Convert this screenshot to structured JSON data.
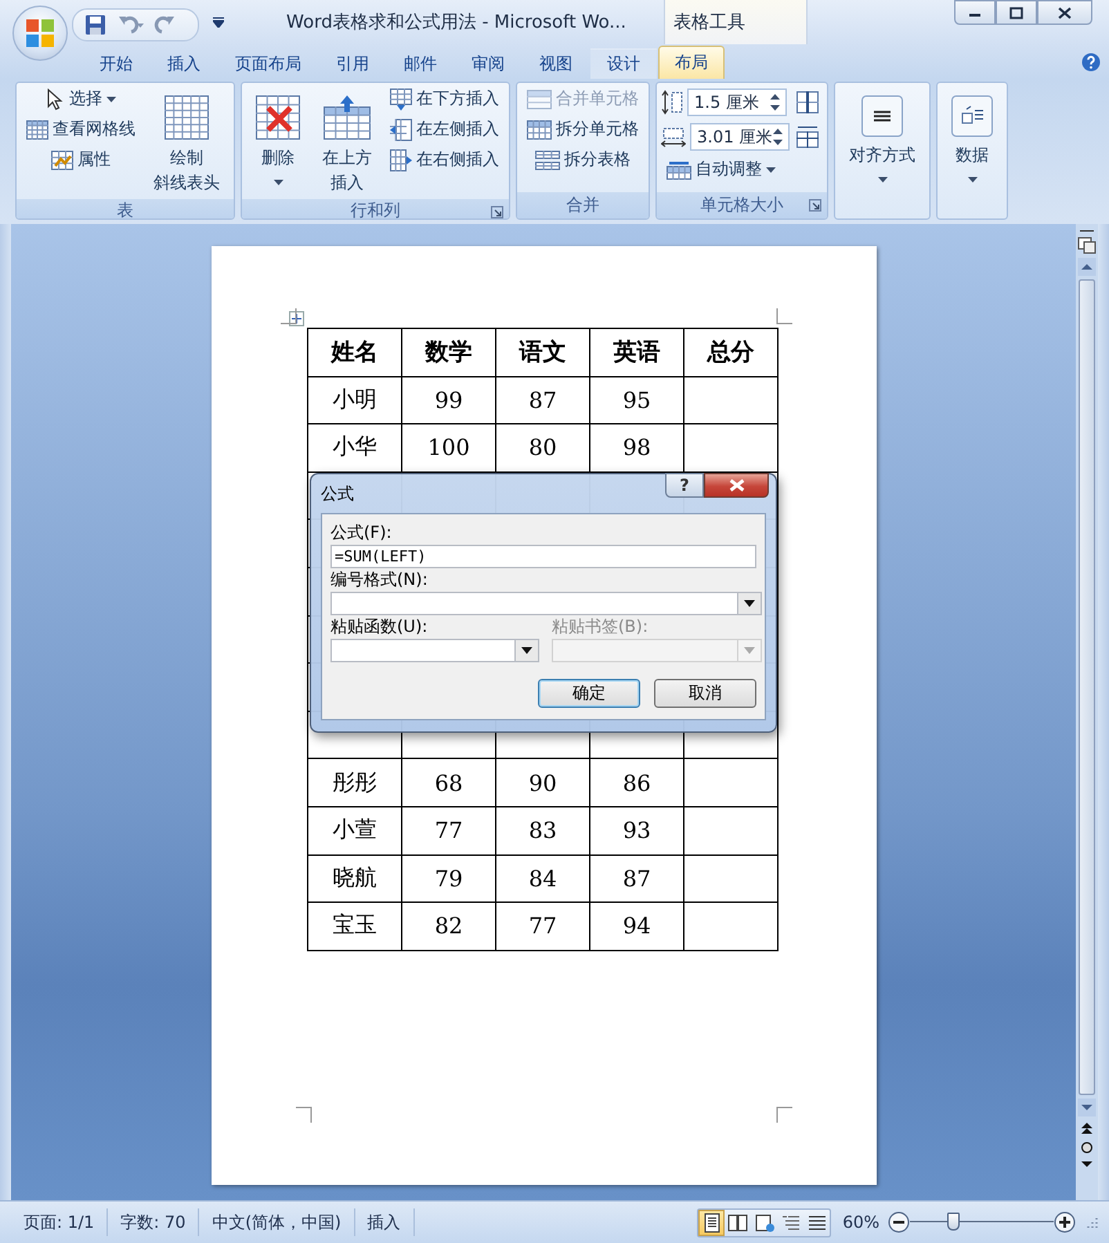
{
  "window": {
    "title": "Word表格求和公式用法 - Microsoft Wo...",
    "context_title": "表格工具"
  },
  "tabs": [
    {
      "label": "开始",
      "selected": false,
      "kind": "main"
    },
    {
      "label": "插入",
      "selected": false,
      "kind": "main"
    },
    {
      "label": "页面布局",
      "selected": false,
      "kind": "main"
    },
    {
      "label": "引用",
      "selected": false,
      "kind": "main"
    },
    {
      "label": "邮件",
      "selected": false,
      "kind": "main"
    },
    {
      "label": "审阅",
      "selected": false,
      "kind": "main"
    },
    {
      "label": "视图",
      "selected": false,
      "kind": "main"
    },
    {
      "label": "设计",
      "selected": false,
      "kind": "context"
    },
    {
      "label": "布局",
      "selected": true,
      "kind": "context"
    }
  ],
  "ribbon": {
    "groups": [
      {
        "label": "表",
        "launcher": false,
        "columns": [
          [
            {
              "kind": "small",
              "label": "选择",
              "dropdown": true,
              "disabled": false
            },
            {
              "kind": "small",
              "label": "查看网格线",
              "dropdown": false,
              "disabled": false
            },
            {
              "kind": "small",
              "label": "属性",
              "dropdown": false,
              "disabled": false
            }
          ],
          [
            {
              "kind": "large",
              "lines": [
                "绘制",
                "斜线表头"
              ],
              "dropdown": false,
              "disabled": false
            }
          ]
        ]
      },
      {
        "label": "行和列",
        "launcher": true,
        "columns": [
          [
            {
              "kind": "large",
              "lines": [
                "删除"
              ],
              "dropdown": true,
              "disabled": false
            }
          ],
          [
            {
              "kind": "large",
              "lines": [
                "在上方",
                "插入"
              ],
              "dropdown": false,
              "disabled": false
            }
          ],
          [
            {
              "kind": "small",
              "label": "在下方插入",
              "dropdown": false,
              "disabled": false
            },
            {
              "kind": "small",
              "label": "在左侧插入",
              "dropdown": false,
              "disabled": false
            },
            {
              "kind": "small",
              "label": "在右侧插入",
              "dropdown": false,
              "disabled": false
            }
          ]
        ]
      },
      {
        "label": "合并",
        "launcher": false,
        "columns": [
          [
            {
              "kind": "small",
              "label": "合并单元格",
              "dropdown": false,
              "disabled": true
            },
            {
              "kind": "small",
              "label": "拆分单元格",
              "dropdown": false,
              "disabled": false
            },
            {
              "kind": "small",
              "label": "拆分表格",
              "dropdown": false,
              "disabled": false
            }
          ]
        ]
      },
      {
        "label": "单元格大小",
        "launcher": true,
        "columns": [
          [
            {
              "kind": "spinner",
              "value": "1.5 厘米"
            },
            {
              "kind": "spinner",
              "value": "3.01 厘米"
            },
            {
              "kind": "small",
              "label": "自动调整",
              "dropdown": true,
              "disabled": false
            }
          ],
          [
            {
              "kind": "icon"
            },
            {
              "kind": "icon"
            }
          ]
        ]
      },
      {
        "launcher": false,
        "columns": [
          [
            {
              "kind": "large",
              "lines": [
                "对齐方式"
              ],
              "dropdown": true,
              "disabled": false
            }
          ]
        ]
      },
      {
        "launcher": false,
        "columns": [
          [
            {
              "kind": "large",
              "lines": [
                "数据"
              ],
              "dropdown": true,
              "disabled": false
            }
          ]
        ]
      }
    ]
  },
  "document": {
    "table": {
      "columns": [
        "姓名",
        "数学",
        "语文",
        "英语",
        "总分"
      ],
      "rows": [
        {
          "covered": false,
          "cells": [
            "小明",
            "99",
            "87",
            "95"
          ]
        },
        {
          "covered": false,
          "cells": [
            "小华",
            "100",
            "80",
            "98"
          ]
        },
        {
          "covered": true
        },
        {
          "covered": true
        },
        {
          "covered": true
        },
        {
          "covered": true
        },
        {
          "covered": true
        },
        {
          "covered": true
        },
        {
          "covered": false,
          "cells": [
            "彤彤",
            "68",
            "90",
            "86"
          ]
        },
        {
          "covered": false,
          "cells": [
            "小萱",
            "77",
            "83",
            "93"
          ]
        },
        {
          "covered": false,
          "cells": [
            "晓航",
            "79",
            "84",
            "87"
          ]
        },
        {
          "covered": false,
          "cells": [
            "宝玉",
            "82",
            "77",
            "94"
          ]
        }
      ]
    }
  },
  "dialog": {
    "title": "公式",
    "help": "?",
    "formula": {
      "label": "公式(F):",
      "value": "=SUM(LEFT)"
    },
    "number_format": {
      "label": "编号格式(N):",
      "disabled": false
    },
    "paste_function": {
      "label": "粘贴函数(U):",
      "disabled": false
    },
    "paste_bookmark": {
      "label": "粘贴书签(B):",
      "disabled": true
    },
    "buttons": [
      {
        "label": "确定",
        "default": true
      },
      {
        "label": "取消",
        "default": false
      }
    ]
  },
  "status_bar": {
    "items": [
      "页面: 1/1",
      "字数: 70",
      "中文(简体，中国)",
      "插入"
    ],
    "views": [
      {
        "selected": true
      },
      {
        "selected": false
      },
      {
        "selected": false
      },
      {
        "selected": false
      },
      {
        "selected": false
      }
    ],
    "zoom": {
      "reading": "60%",
      "level": 0.3
    }
  }
}
